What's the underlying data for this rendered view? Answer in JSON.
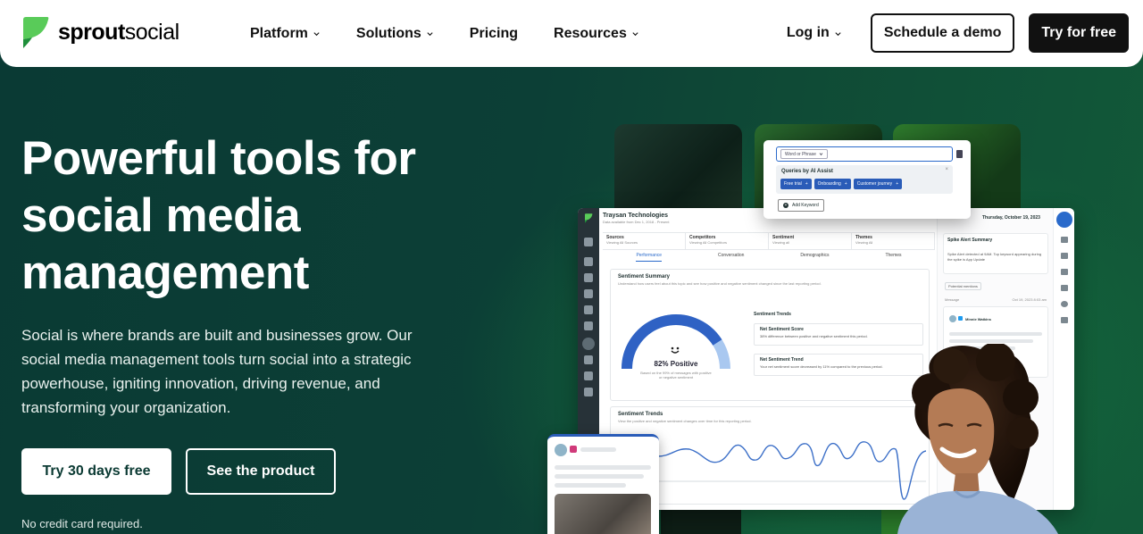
{
  "brand": {
    "name_bold": "sprout",
    "name_light": "social",
    "accent": "#59cb59"
  },
  "nav": {
    "items": [
      {
        "label": "Platform",
        "has_dropdown": true
      },
      {
        "label": "Solutions",
        "has_dropdown": true
      },
      {
        "label": "Pricing",
        "has_dropdown": false
      },
      {
        "label": "Resources",
        "has_dropdown": true
      }
    ],
    "login": "Log in",
    "demo": "Schedule a demo",
    "try": "Try for free"
  },
  "hero": {
    "title_line1": "Powerful tools for",
    "title_line2": "social media",
    "title_line3": "management",
    "subtitle": "Social is where brands are built and businesses grow. Our social media management tools turn social into a strategic powerhouse, igniting innovation, driving revenue, and transforming your organization.",
    "cta_primary": "Try 30 days free",
    "cta_secondary": "See the product",
    "note": "No credit card required."
  },
  "dashboard": {
    "title": "Traysan Technologies",
    "subtitle": "Data available from Dec 1, 2018 - Present",
    "filters": [
      {
        "label": "Sources",
        "value": "Viewing All Sources"
      },
      {
        "label": "Competitors",
        "value": "Viewing All Competitors"
      },
      {
        "label": "Sentiment",
        "value": "Viewing all"
      },
      {
        "label": "Themes",
        "value": "Viewing All"
      }
    ],
    "tabs": [
      "Performance",
      "Conversation",
      "Demographics",
      "Themes"
    ],
    "sentiment_summary": {
      "title": "Sentiment Summary",
      "desc": "Understand how users feel about this topic and see how positive and negative sentiment changed since the last reporting period.",
      "gauge_value": "82% Positive",
      "gauge_fraction": 0.82,
      "gauge_caption": "Based on the 99% of messages with positive or negative sentiment",
      "trends_label": "Sentiment Trends",
      "net_score_title": "Net Sentiment Score",
      "net_score_desc": "38% difference between positive and negative sentiment this period.",
      "net_trend_title": "Net Sentiment Trend",
      "net_trend_desc": "Your net sentiment score decreased by 11% compared to the previous period."
    },
    "trends_card": {
      "title": "Sentiment Trends",
      "desc": "View the positive and negative sentiment changes over time for this reporting period."
    },
    "right_panel": {
      "date": "Thursday, October 19, 2023",
      "spike_title": "Spike Alert Summary",
      "spike_desc": "Spike Alert detected at 9AM. Top keyword appearing during the spike is App Update",
      "filter": "Potential mentions",
      "msg_label": "Message",
      "msg_date": "Oct 19, 2023 8:03 am",
      "author": "Minnie Watkins"
    }
  },
  "popup": {
    "select": "Word or Phrase",
    "box_title": "Queries by AI Assist",
    "tags": [
      "Free trial",
      "Onboarding",
      "Customer journey"
    ],
    "add": "Add Keyword"
  }
}
